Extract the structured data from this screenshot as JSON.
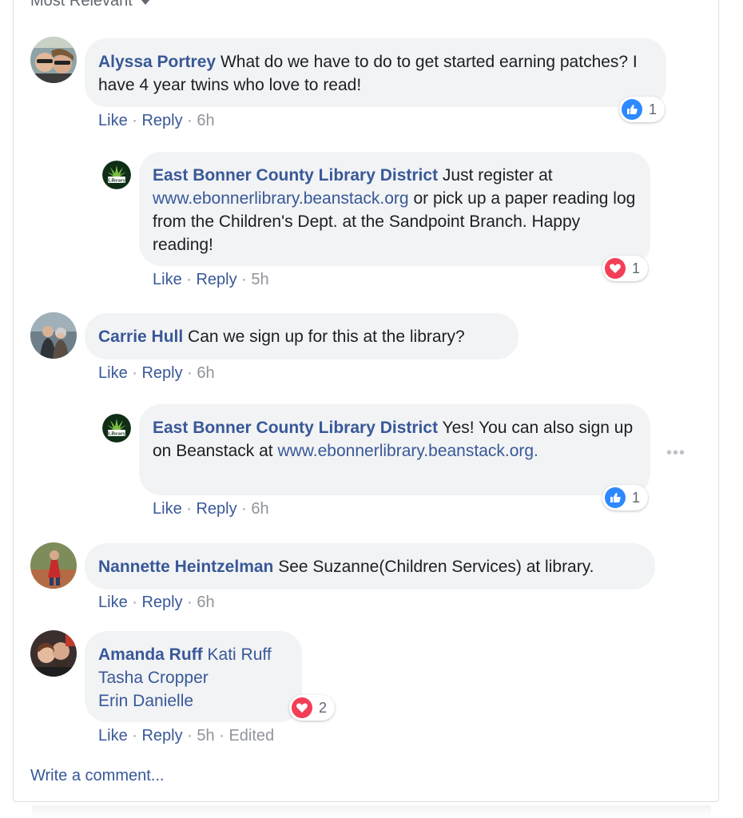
{
  "sort": {
    "label": "Most Relevant"
  },
  "colors": {
    "link": "#385898",
    "bubble": "#f2f3f5",
    "like": "#2e89ff",
    "love": "#f33e58",
    "meta": "#90949c"
  },
  "comments": [
    {
      "author": "Alyssa Portrey",
      "text": "What do we have to do to get started earning patches? I have 4 year twins who love to read!",
      "like_label": "Like",
      "reply_label": "Reply",
      "time": "6h",
      "reaction": {
        "icon": "like-icon",
        "count": "1"
      },
      "replies": [
        {
          "author": "East Bonner County Library District",
          "text_before": "Just register at",
          "link": "www.ebonnerlibrary.beanstack.org",
          "text_after": "or pick up a paper reading log from the Children's Dept. at the Sandpoint Branch. Happy reading!",
          "like_label": "Like",
          "reply_label": "Reply",
          "time": "5h",
          "reaction": {
            "icon": "love-icon",
            "count": "1"
          }
        }
      ]
    },
    {
      "author": "Carrie Hull",
      "text": "Can we sign up for this at the library?",
      "like_label": "Like",
      "reply_label": "Reply",
      "time": "6h",
      "replies": [
        {
          "author": "East Bonner County Library District",
          "text_before": "Yes! You can also sign up on Beanstack at",
          "link": "www.ebonnerlibrary.beanstack.org.",
          "like_label": "Like",
          "reply_label": "Reply",
          "time": "6h",
          "reaction": {
            "icon": "like-icon",
            "count": "1"
          },
          "more_icon": "more-options-icon"
        }
      ]
    },
    {
      "author": "Nannette Heintzelman",
      "text": "See Suzanne(Children Services) at library.",
      "like_label": "Like",
      "reply_label": "Reply",
      "time": "6h"
    },
    {
      "author": "Amanda Ruff",
      "tags": [
        "Kati Ruff",
        "Tasha Cropper",
        "Erin Danielle"
      ],
      "like_label": "Like",
      "reply_label": "Reply",
      "time": "5h",
      "edited": "Edited",
      "reaction": {
        "icon": "love-icon",
        "count": "2"
      }
    }
  ],
  "write_comment": "Write a comment..."
}
